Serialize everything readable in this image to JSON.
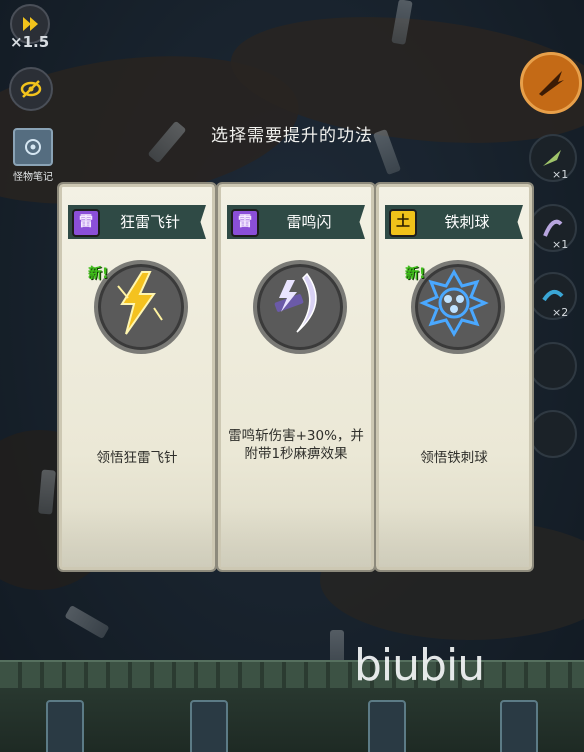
{
  "hud": {
    "speed_label": "×1.5",
    "bestiary_label": "怪物笔记",
    "slot_counts": [
      "×1",
      "×1",
      "×2"
    ]
  },
  "dialog": {
    "title": "选择需要提升的功法",
    "cards": [
      {
        "badge": "雷",
        "badge_type": "thunder",
        "name": "狂雷飞针",
        "new_tag": "新!",
        "icon": "lightning-needle-icon",
        "description": "领悟狂雷飞针"
      },
      {
        "badge": "雷",
        "badge_type": "thunder",
        "name": "雷鸣闪",
        "new_tag": "",
        "icon": "thunder-slash-icon",
        "description": "雷鸣斩伤害+30%，并附带1秒麻痹效果"
      },
      {
        "badge": "土",
        "badge_type": "earth",
        "name": "铁刺球",
        "new_tag": "新!",
        "icon": "spiked-ball-icon",
        "description": "领悟铁刺球"
      }
    ]
  },
  "watermark": "biubiu",
  "colors": {
    "banner": "#2f4a45",
    "card": "#f3f1e4",
    "thunder_badge": "#8b4fd8",
    "earth_badge": "#f0c21a",
    "new_tag": "#3fbe1a"
  }
}
